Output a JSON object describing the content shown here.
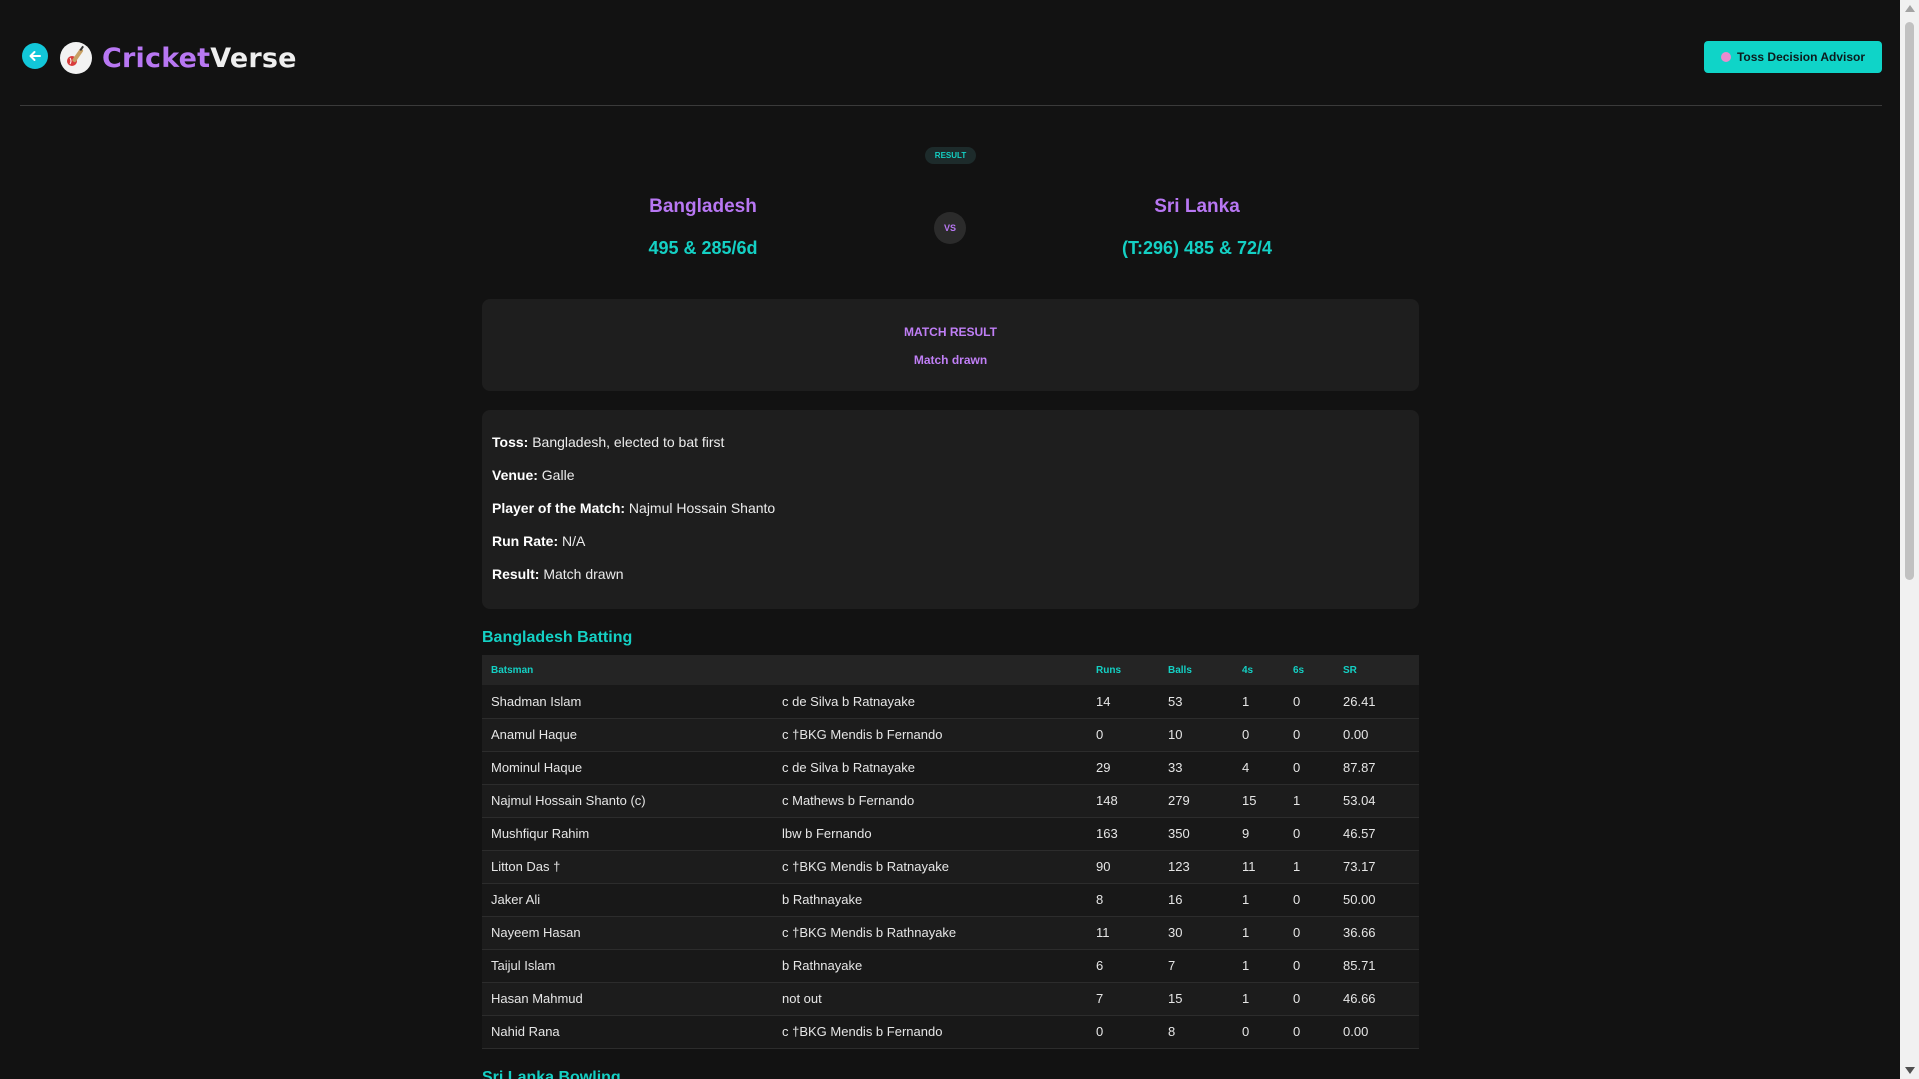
{
  "header": {
    "brand_part1": "Cricket",
    "brand_part2": "Verse",
    "toss_button_label": "Toss Decision Advisor"
  },
  "match": {
    "status_badge": "RESULT",
    "vs_label": "VS",
    "team1": {
      "name": "Bangladesh",
      "score": "495 & 285/6d"
    },
    "team2": {
      "name": "Sri Lanka",
      "score": "(T:296) 485 & 72/4"
    }
  },
  "match_result": {
    "title": "MATCH RESULT",
    "value": "Match drawn"
  },
  "info": {
    "toss_label": "Toss:",
    "toss_value": "Bangladesh, elected to bat first",
    "venue_label": "Venue:",
    "venue_value": "Galle",
    "potm_label": "Player of the Match:",
    "potm_value": "Najmul Hossain Shanto",
    "run_rate_label": "Run Rate:",
    "run_rate_value": "N/A",
    "result_label": "Result:",
    "result_value": "Match drawn"
  },
  "batting": {
    "title": "Bangladesh Batting",
    "columns": [
      "Batsman",
      "",
      "Runs",
      "Balls",
      "4s",
      "6s",
      "SR"
    ],
    "rows": [
      [
        "Shadman Islam",
        "c de Silva b Ratnayake",
        "14",
        "53",
        "1",
        "0",
        "26.41"
      ],
      [
        "Anamul Haque",
        "c †BKG Mendis b Fernando",
        "0",
        "10",
        "0",
        "0",
        "0.00"
      ],
      [
        "Mominul Haque",
        "c de Silva b Ratnayake",
        "29",
        "33",
        "4",
        "0",
        "87.87"
      ],
      [
        "Najmul Hossain Shanto (c)",
        "c Mathews b Fernando",
        "148",
        "279",
        "15",
        "1",
        "53.04"
      ],
      [
        "Mushfiqur Rahim",
        "lbw b Fernando",
        "163",
        "350",
        "9",
        "0",
        "46.57"
      ],
      [
        "Litton Das †",
        "c †BKG Mendis b Ratnayake",
        "90",
        "123",
        "11",
        "1",
        "73.17"
      ],
      [
        "Jaker Ali",
        "b Rathnayake",
        "8",
        "16",
        "1",
        "0",
        "50.00"
      ],
      [
        "Nayeem Hasan",
        "c †BKG Mendis b Rathnayake",
        "11",
        "30",
        "1",
        "0",
        "36.66"
      ],
      [
        "Taijul Islam",
        "b Rathnayake",
        "6",
        "7",
        "1",
        "0",
        "85.71"
      ],
      [
        "Hasan Mahmud",
        "not out",
        "7",
        "15",
        "1",
        "0",
        "46.66"
      ],
      [
        "Nahid Rana",
        "c †BKG Mendis b Fernando",
        "0",
        "8",
        "0",
        "0",
        "0.00"
      ]
    ]
  },
  "bowling": {
    "title": "Sri Lanka Bowling"
  },
  "icons": {
    "back": "arrow-left-icon",
    "logo": "cricket-ball-icon",
    "toss": "brain-icon"
  },
  "colors": {
    "accent_purple": "#b877f3",
    "accent_teal": "#14d0c4",
    "background": "#121212"
  }
}
